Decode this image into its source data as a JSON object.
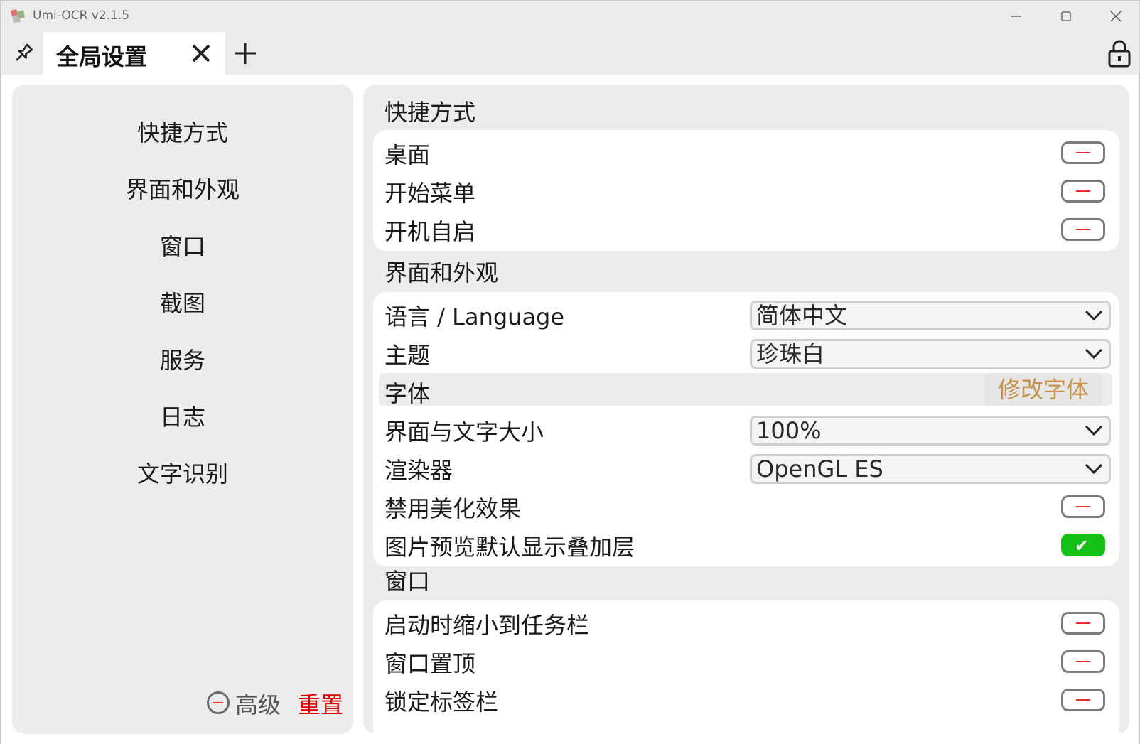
{
  "window": {
    "title": "Umi-OCR v2.1.5"
  },
  "tabs": [
    {
      "label": "全局设置"
    }
  ],
  "sidebar": {
    "items": [
      {
        "label": "快捷方式"
      },
      {
        "label": "界面和外观"
      },
      {
        "label": "窗口"
      },
      {
        "label": "截图"
      },
      {
        "label": "服务"
      },
      {
        "label": "日志"
      },
      {
        "label": "文字识别"
      }
    ],
    "advanced_label": "高级",
    "reset_label": "重置"
  },
  "sections": {
    "shortcuts": {
      "title": "快捷方式",
      "rows": [
        {
          "label": "桌面",
          "enabled": false
        },
        {
          "label": "开始菜单",
          "enabled": false
        },
        {
          "label": "开机自启",
          "enabled": false
        }
      ]
    },
    "ui": {
      "title": "界面和外观",
      "language": {
        "label": "语言 / Language",
        "value": "简体中文"
      },
      "theme": {
        "label": "主题",
        "value": "珍珠白"
      },
      "font": {
        "label": "字体",
        "button": "修改字体"
      },
      "scale": {
        "label": "界面与文字大小",
        "value": "100%"
      },
      "renderer": {
        "label": "渲染器",
        "value": "OpenGL ES"
      },
      "disable_effects": {
        "label": "禁用美化效果",
        "enabled": false
      },
      "overlay": {
        "label": "图片预览默认显示叠加层",
        "enabled": true
      }
    },
    "window": {
      "title": "窗口",
      "rows": [
        {
          "label": "启动时缩小到任务栏",
          "enabled": false
        },
        {
          "label": "窗口置顶",
          "enabled": false
        },
        {
          "label": "锁定标签栏",
          "enabled": false
        }
      ]
    }
  },
  "colors": {
    "accent_green": "#17c017",
    "reset_red": "#e00000",
    "font_button": "#c8924a"
  }
}
